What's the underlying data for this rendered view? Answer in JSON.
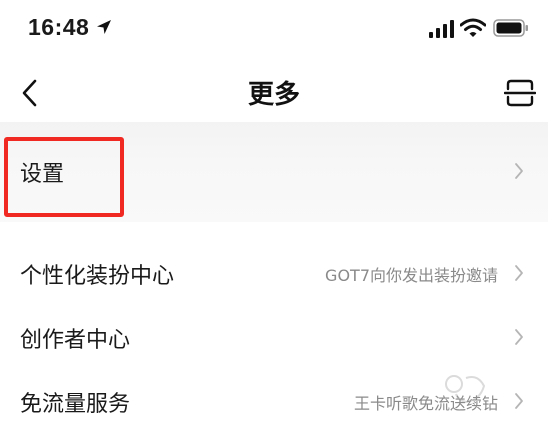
{
  "status_bar": {
    "time": "16:48"
  },
  "nav": {
    "title": "更多"
  },
  "settings": {
    "label": "设置"
  },
  "list": [
    {
      "label": "个性化装扮中心",
      "value": "GOT7向你发出装扮邀请"
    },
    {
      "label": "创作者中心",
      "value": ""
    },
    {
      "label": "免流量服务",
      "value": "王卡听歌免流送续钻"
    }
  ],
  "colors": {
    "highlight": "#f02a23",
    "secondary_text": "#8a8a8a",
    "chevron": "#b5b5b5"
  }
}
